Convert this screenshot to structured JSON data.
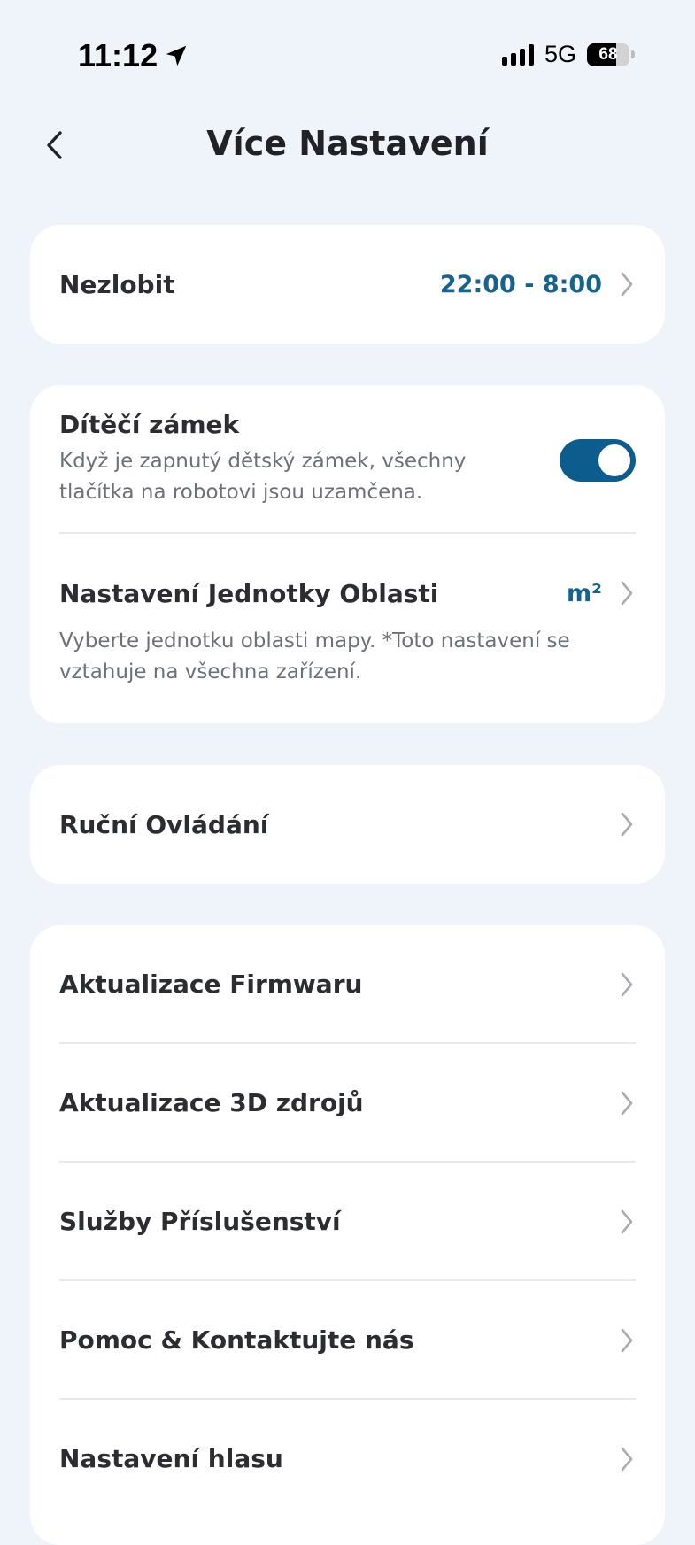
{
  "status_bar": {
    "time": "11:12",
    "location_icon": "location-arrow-icon",
    "network": "5G",
    "battery": "68",
    "battery_level": 0.68
  },
  "header": {
    "title": "Více Nastavení",
    "back_icon": "chevron-left-icon"
  },
  "colors": {
    "background": "#eff4fb",
    "card": "#ffffff",
    "accent": "#17638f",
    "toggle_on": "#0c5d8e",
    "text": "#2b2d31",
    "secondary_text": "#6d7075",
    "chevron": "#a9acb0"
  },
  "do_not_disturb": {
    "label": "Nezlobit",
    "value": "22:00 - 8:00"
  },
  "child_lock": {
    "label": "Dítěčí zámek",
    "description_line1": "Když je zapnutý dětský zámek, všechny",
    "description_line2": "tlačítka na robotovi jsou uzamčena.",
    "enabled": true
  },
  "area_unit": {
    "label": "Nastavení Jednotky Oblasti",
    "value": "m²",
    "description_line1": "Vyberte jednotku oblasti mapy. *Toto nastavení se",
    "description_line2": "vztahuje na všechna zařízení."
  },
  "manual_control": {
    "label": "Ruční Ovládání"
  },
  "menu_items": [
    {
      "label": "Aktualizace Firmwaru"
    },
    {
      "label": "Aktualizace 3D zdrojů"
    },
    {
      "label": "Služby Příslušenství"
    },
    {
      "label": "Pomoc & Kontaktujte nás"
    },
    {
      "label": "Nastavení hlasu"
    }
  ]
}
